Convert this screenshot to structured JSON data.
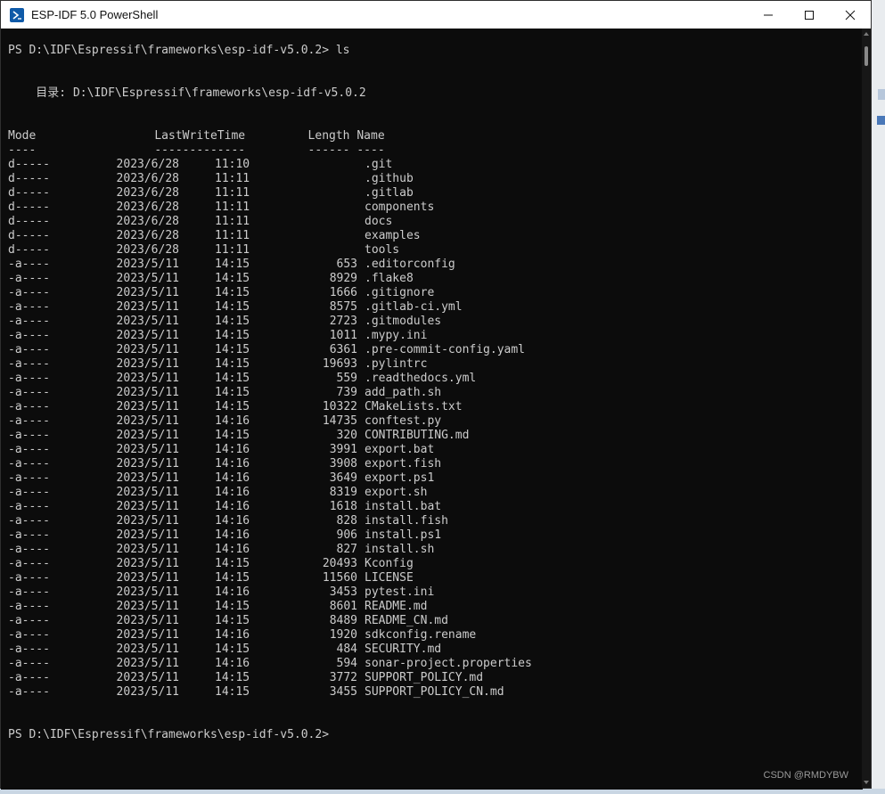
{
  "window": {
    "title": "ESP-IDF 5.0 PowerShell",
    "minimize": "minimize",
    "maximize": "maximize",
    "close": "close"
  },
  "terminal": {
    "command_line": "PS D:\\IDF\\Espressif\\frameworks\\esp-idf-v5.0.2> ls",
    "directory_line": "    目录: D:\\IDF\\Espressif\\frameworks\\esp-idf-v5.0.2",
    "header_line": "Mode                 LastWriteTime         Length Name",
    "separator_line": "----                 -------------         ------ ----",
    "final_prompt": "PS D:\\IDF\\Espressif\\frameworks\\esp-idf-v5.0.2>",
    "entries": [
      {
        "mode": "d-----",
        "date": "2023/6/28",
        "time": "11:10",
        "length": "",
        "name": ".git"
      },
      {
        "mode": "d-----",
        "date": "2023/6/28",
        "time": "11:11",
        "length": "",
        "name": ".github"
      },
      {
        "mode": "d-----",
        "date": "2023/6/28",
        "time": "11:11",
        "length": "",
        "name": ".gitlab"
      },
      {
        "mode": "d-----",
        "date": "2023/6/28",
        "time": "11:11",
        "length": "",
        "name": "components"
      },
      {
        "mode": "d-----",
        "date": "2023/6/28",
        "time": "11:11",
        "length": "",
        "name": "docs"
      },
      {
        "mode": "d-----",
        "date": "2023/6/28",
        "time": "11:11",
        "length": "",
        "name": "examples"
      },
      {
        "mode": "d-----",
        "date": "2023/6/28",
        "time": "11:11",
        "length": "",
        "name": "tools"
      },
      {
        "mode": "-a----",
        "date": "2023/5/11",
        "time": "14:15",
        "length": "653",
        "name": ".editorconfig"
      },
      {
        "mode": "-a----",
        "date": "2023/5/11",
        "time": "14:15",
        "length": "8929",
        "name": ".flake8"
      },
      {
        "mode": "-a----",
        "date": "2023/5/11",
        "time": "14:15",
        "length": "1666",
        "name": ".gitignore"
      },
      {
        "mode": "-a----",
        "date": "2023/5/11",
        "time": "14:15",
        "length": "8575",
        "name": ".gitlab-ci.yml"
      },
      {
        "mode": "-a----",
        "date": "2023/5/11",
        "time": "14:15",
        "length": "2723",
        "name": ".gitmodules"
      },
      {
        "mode": "-a----",
        "date": "2023/5/11",
        "time": "14:15",
        "length": "1011",
        "name": ".mypy.ini"
      },
      {
        "mode": "-a----",
        "date": "2023/5/11",
        "time": "14:15",
        "length": "6361",
        "name": ".pre-commit-config.yaml"
      },
      {
        "mode": "-a----",
        "date": "2023/5/11",
        "time": "14:15",
        "length": "19693",
        "name": ".pylintrc"
      },
      {
        "mode": "-a----",
        "date": "2023/5/11",
        "time": "14:15",
        "length": "559",
        "name": ".readthedocs.yml"
      },
      {
        "mode": "-a----",
        "date": "2023/5/11",
        "time": "14:15",
        "length": "739",
        "name": "add_path.sh"
      },
      {
        "mode": "-a----",
        "date": "2023/5/11",
        "time": "14:15",
        "length": "10322",
        "name": "CMakeLists.txt"
      },
      {
        "mode": "-a----",
        "date": "2023/5/11",
        "time": "14:16",
        "length": "14735",
        "name": "conftest.py"
      },
      {
        "mode": "-a----",
        "date": "2023/5/11",
        "time": "14:15",
        "length": "320",
        "name": "CONTRIBUTING.md"
      },
      {
        "mode": "-a----",
        "date": "2023/5/11",
        "time": "14:16",
        "length": "3991",
        "name": "export.bat"
      },
      {
        "mode": "-a----",
        "date": "2023/5/11",
        "time": "14:16",
        "length": "3908",
        "name": "export.fish"
      },
      {
        "mode": "-a----",
        "date": "2023/5/11",
        "time": "14:16",
        "length": "3649",
        "name": "export.ps1"
      },
      {
        "mode": "-a----",
        "date": "2023/5/11",
        "time": "14:16",
        "length": "8319",
        "name": "export.sh"
      },
      {
        "mode": "-a----",
        "date": "2023/5/11",
        "time": "14:16",
        "length": "1618",
        "name": "install.bat"
      },
      {
        "mode": "-a----",
        "date": "2023/5/11",
        "time": "14:16",
        "length": "828",
        "name": "install.fish"
      },
      {
        "mode": "-a----",
        "date": "2023/5/11",
        "time": "14:16",
        "length": "906",
        "name": "install.ps1"
      },
      {
        "mode": "-a----",
        "date": "2023/5/11",
        "time": "14:16",
        "length": "827",
        "name": "install.sh"
      },
      {
        "mode": "-a----",
        "date": "2023/5/11",
        "time": "14:15",
        "length": "20493",
        "name": "Kconfig"
      },
      {
        "mode": "-a----",
        "date": "2023/5/11",
        "time": "14:15",
        "length": "11560",
        "name": "LICENSE"
      },
      {
        "mode": "-a----",
        "date": "2023/5/11",
        "time": "14:16",
        "length": "3453",
        "name": "pytest.ini"
      },
      {
        "mode": "-a----",
        "date": "2023/5/11",
        "time": "14:15",
        "length": "8601",
        "name": "README.md"
      },
      {
        "mode": "-a----",
        "date": "2023/5/11",
        "time": "14:15",
        "length": "8489",
        "name": "README_CN.md"
      },
      {
        "mode": "-a----",
        "date": "2023/5/11",
        "time": "14:16",
        "length": "1920",
        "name": "sdkconfig.rename"
      },
      {
        "mode": "-a----",
        "date": "2023/5/11",
        "time": "14:15",
        "length": "484",
        "name": "SECURITY.md"
      },
      {
        "mode": "-a----",
        "date": "2023/5/11",
        "time": "14:16",
        "length": "594",
        "name": "sonar-project.properties"
      },
      {
        "mode": "-a----",
        "date": "2023/5/11",
        "time": "14:15",
        "length": "3772",
        "name": "SUPPORT_POLICY.md"
      },
      {
        "mode": "-a----",
        "date": "2023/5/11",
        "time": "14:15",
        "length": "3455",
        "name": "SUPPORT_POLICY_CN.md"
      }
    ]
  },
  "watermark": "CSDN @RMDYBW",
  "colors": {
    "terminal_bg": "#0c0c0c",
    "terminal_fg": "#cccccc",
    "titlebar_bg": "#ffffff",
    "icon_blue": "#0f5aa8"
  },
  "icons": {
    "app": "powershell-icon",
    "minimize": "minimize-icon",
    "maximize": "maximize-icon",
    "close": "close-icon"
  }
}
